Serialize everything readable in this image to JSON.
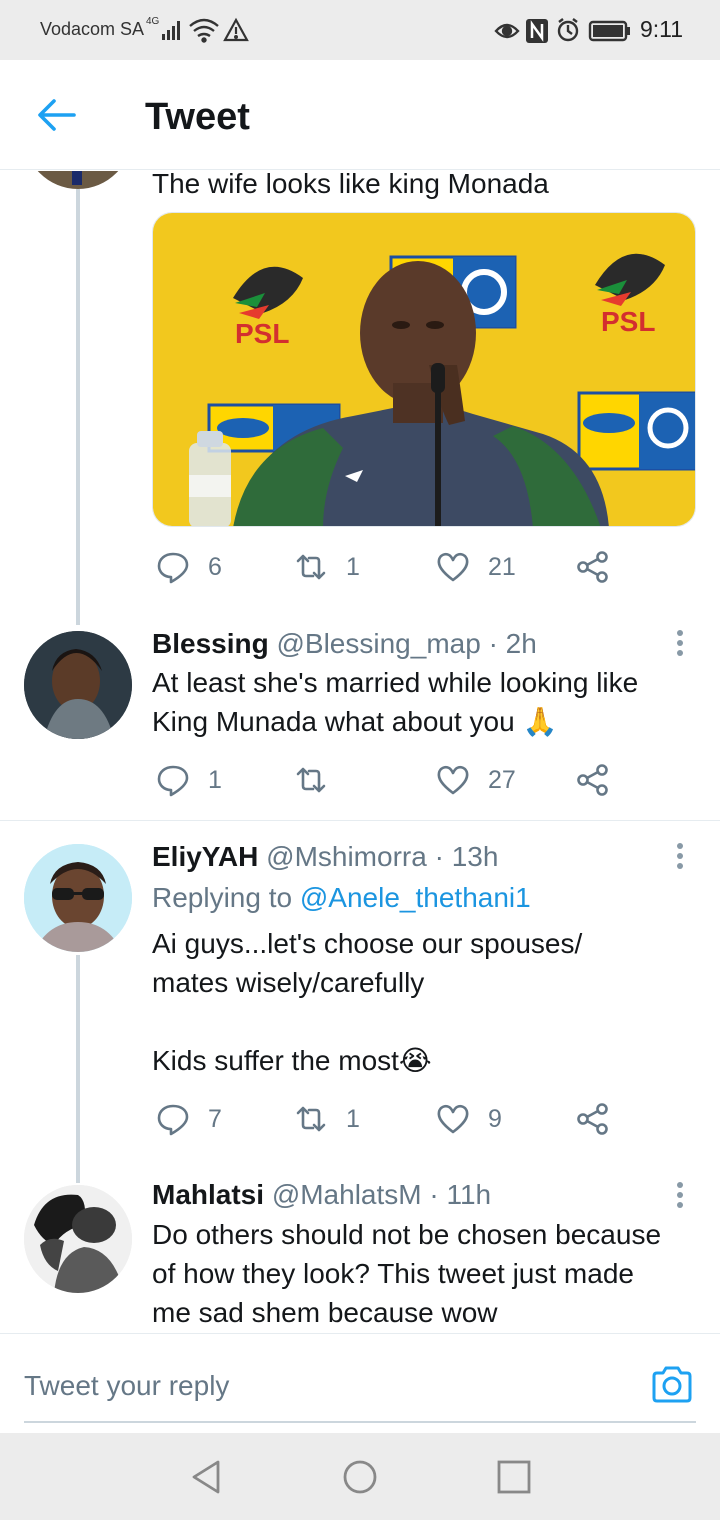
{
  "status_bar": {
    "carrier": "Vodacom SA",
    "network": "4G",
    "time": "9:11",
    "icons": [
      "signal-icon",
      "wifi-icon",
      "warning-icon",
      "eye-icon",
      "nfc-icon",
      "alarm-icon",
      "battery-icon"
    ]
  },
  "header": {
    "title": "Tweet",
    "back_icon": "back-arrow-icon"
  },
  "tweets": [
    {
      "text": "The wife looks like king Monada",
      "has_photo": true,
      "photo_description_icons": [
        "psl-logo",
        "mtn8-logo"
      ],
      "replies": "6",
      "retweets": "1",
      "likes": "21"
    },
    {
      "name": "Blessing",
      "handle": "@Blessing_map",
      "time": "· 2h",
      "lines": [
        "At least she's married while looking like",
        "King Munada what about you 🙏"
      ],
      "replies": "1",
      "retweets": "",
      "likes": "27"
    },
    {
      "name": "EliyYAH",
      "handle": "@Mshimorra",
      "time": "· 13h",
      "replying_prefix": "Replying to",
      "replying_handle": "@Anele_thethani1",
      "lines": [
        "Ai guys...let's choose our spouses/",
        "mates wisely/carefully",
        "",
        "Kids suffer the most😭"
      ],
      "replies": "7",
      "retweets": "1",
      "likes": "9"
    },
    {
      "name": "Mahlatsi",
      "handle": "@MahlatsM",
      "time": "· 11h",
      "lines": [
        "Do others should not be chosen because",
        "of how they look? This tweet just made",
        "me sad shem because wow"
      ]
    }
  ],
  "compose": {
    "placeholder": "Tweet your reply"
  },
  "colors": {
    "accent": "#1da1f2",
    "secondary_text": "#657786",
    "thread_line": "#ccd6dd",
    "photo_bg": "#f2c81e"
  }
}
